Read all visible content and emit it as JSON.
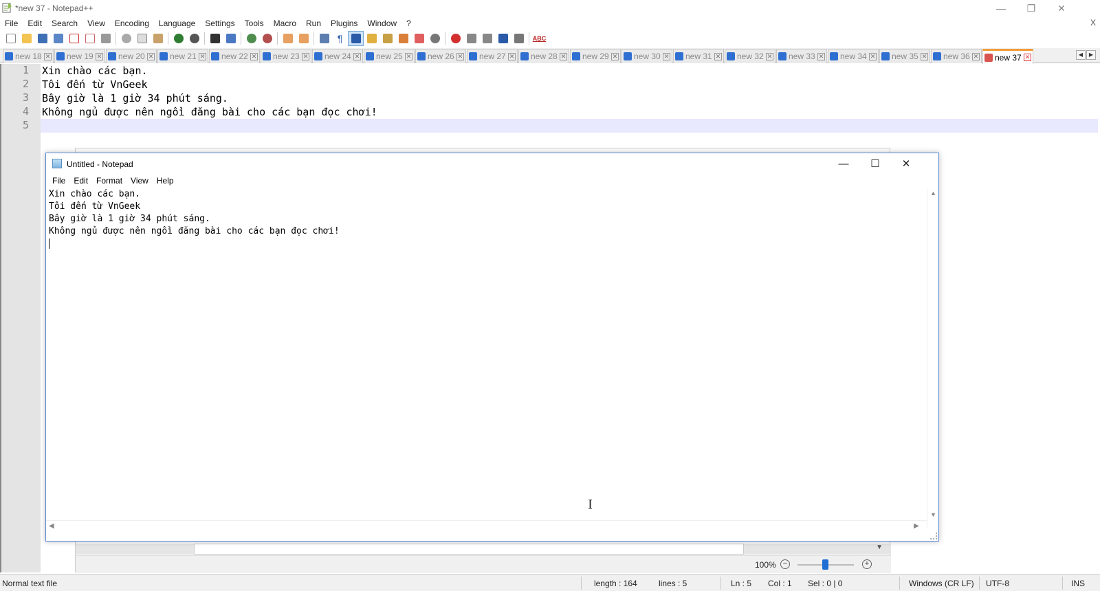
{
  "npp": {
    "title": "*new 37 - Notepad++",
    "menu": [
      "File",
      "Edit",
      "Search",
      "View",
      "Encoding",
      "Language",
      "Settings",
      "Tools",
      "Macro",
      "Run",
      "Plugins",
      "Window",
      "?"
    ],
    "mdi_close": "X",
    "tabs": [
      "new 18",
      "new 19",
      "new 20",
      "new 21",
      "new 22",
      "new 23",
      "new 24",
      "new 25",
      "new 26",
      "new 27",
      "new 28",
      "new 29",
      "new 30",
      "new 31",
      "new 32",
      "new 33",
      "new 34",
      "new 35",
      "new 36",
      "new 37"
    ],
    "active_tab": "new 37",
    "line_numbers": [
      "1",
      "2",
      "3",
      "4",
      "5"
    ],
    "lines": [
      "Xin chào các bạn.",
      "Tôi đến từ VnGeek",
      "Bây giờ là 1 giờ 34 phút sáng.",
      "Không ngủ được nên ngồi đăng bài cho các bạn đọc chơi!",
      ""
    ],
    "zoom": "100%",
    "status": {
      "file_type": "Normal text file",
      "length": "length : 164",
      "lines": "lines : 5",
      "ln": "Ln : 5",
      "col": "Col : 1",
      "sel": "Sel : 0 | 0",
      "eol": "Windows (CR LF)",
      "encoding": "UTF-8",
      "mode": "INS"
    }
  },
  "notepad": {
    "title": "Untitled - Notepad",
    "menu": [
      "File",
      "Edit",
      "Format",
      "View",
      "Help"
    ],
    "lines": [
      "Xin chào các bạn.",
      "Tôi đến từ VnGeek",
      "Bây giờ là 1 giờ 34 phút sáng.",
      "Không ngủ được nên ngồi đăng bài cho các bạn đọc chơi!"
    ]
  },
  "colors": {
    "tab_active_accent": "#f29c3a",
    "current_line": "#e8e8ff",
    "gutter": "#e4e4e4",
    "notepad_border": "#5a8ad6"
  }
}
